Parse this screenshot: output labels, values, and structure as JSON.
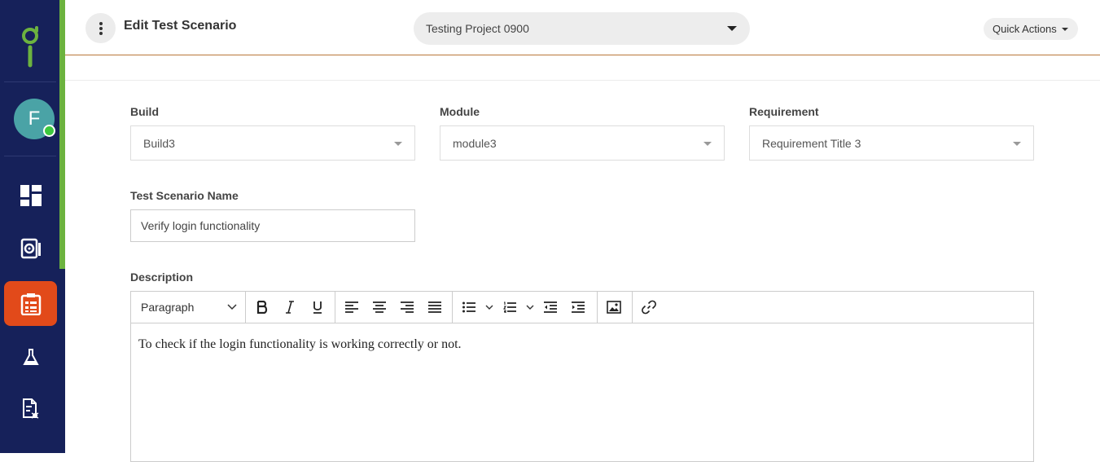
{
  "sidebar": {
    "avatar_initial": "F",
    "items": [
      {
        "icon": "dashboard-icon"
      },
      {
        "icon": "settings-document-icon"
      },
      {
        "icon": "test-scenario-icon",
        "active": true
      },
      {
        "icon": "flask-icon"
      },
      {
        "icon": "bug-report-icon"
      }
    ],
    "accent_color": "#6cb33f",
    "active_color": "#e24a1a",
    "background": "#16215a"
  },
  "header": {
    "title": "Edit Test Scenario",
    "project": "Testing Project 0900",
    "quick_actions": "Quick Actions"
  },
  "form": {
    "build": {
      "label": "Build",
      "value": "Build3"
    },
    "module": {
      "label": "Module",
      "value": "module3"
    },
    "requirement": {
      "label": "Requirement",
      "value": "Requirement Title 3"
    },
    "name": {
      "label": "Test Scenario Name",
      "value": "Verify login functionality"
    },
    "description": {
      "label": "Description",
      "format": "Paragraph",
      "content": "To check if the login functionality is working correctly or not."
    }
  }
}
